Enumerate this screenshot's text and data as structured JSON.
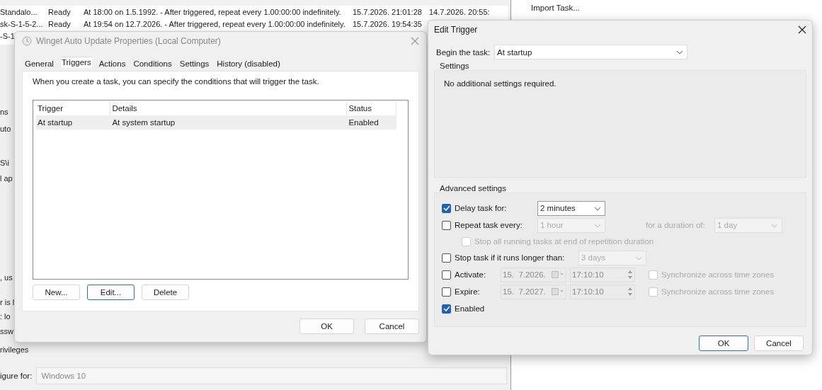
{
  "background": {
    "task_rows": [
      {
        "name": "Standalo...",
        "status": "Ready",
        "triggers": "At 18:00 on 1.5.1992. - After triggered, repeat every 1.00:00:00 indefinitely.",
        "next_run": "15.7.2026. 21:01:28",
        "last_run": "14.7.2026. 20:55:"
      },
      {
        "name": "sk-S-1-5-2...",
        "status": "Ready",
        "triggers": "At 19:54 on 12.7.2026. - After triggered, repeat every 1.00:00:00 indefinitely.",
        "next_run": "15.7.2026. 19:54:35"
      },
      {
        "name": "-S-1"
      }
    ],
    "actions": [
      "Import Task..."
    ],
    "fragments": [
      "ns",
      "uto",
      "S\\i",
      "l ap",
      ", us",
      "r is l",
      ": lo",
      "ssw",
      "rivileges"
    ],
    "configure": {
      "label": "igure for:",
      "value": "Windows 10"
    }
  },
  "properties": {
    "title": "Winget Auto Update Properties (Local Computer)",
    "tabs": [
      {
        "label": "General",
        "selected": false
      },
      {
        "label": "Triggers",
        "selected": true
      },
      {
        "label": "Actions",
        "selected": false
      },
      {
        "label": "Conditions",
        "selected": false
      },
      {
        "label": "Settings",
        "selected": false
      },
      {
        "label": "History (disabled)",
        "selected": false
      }
    ],
    "description": "When you create a task, you can specify the conditions that will trigger the task.",
    "table": {
      "columns": [
        "Trigger",
        "Details",
        "Status"
      ],
      "rows": [
        {
          "cells": [
            "At startup",
            "At system startup",
            "Enabled"
          ],
          "selected": true
        }
      ]
    },
    "buttons": [
      {
        "label": "New...",
        "focused": false
      },
      {
        "label": "Edit...",
        "focused": true
      },
      {
        "label": "Delete",
        "focused": false
      }
    ],
    "footer_buttons": [
      {
        "label": "OK",
        "focused": false
      },
      {
        "label": "Cancel",
        "focused": false
      }
    ]
  },
  "edit_trigger": {
    "title": "Edit Trigger",
    "begin_label": "Begin the task:",
    "begin_value": "At startup",
    "settings_title": "Settings",
    "settings_text": "No additional settings required.",
    "advanced_title": "Advanced settings",
    "advanced": [
      {
        "kind": "dropdown",
        "label": "Delay task for:",
        "checked": true,
        "value": "2 minutes"
      },
      {
        "kind": "repeat",
        "label": "Repeat task every:",
        "checked": false,
        "value": "1 hour",
        "duration_label": "for a duration of:",
        "duration": "1 day"
      },
      {
        "kind": "sub",
        "label": "Stop all running tasks at end of repetition duration",
        "checked": false
      },
      {
        "kind": "dropdown",
        "label": "Stop task if it runs longer than:",
        "checked": false,
        "value": "3 days"
      },
      {
        "kind": "date",
        "label": "Activate:",
        "checked": false,
        "date": "15.  7.2026.",
        "time": "17:10:10",
        "sync_label": "Synchronize across time zones",
        "sync_checked": false
      },
      {
        "kind": "date",
        "label": "Expire:",
        "checked": false,
        "date": "15.  7.2027.",
        "time": "17:10:10",
        "sync_label": "Synchronize across time zones",
        "sync_checked": false
      },
      {
        "kind": "check",
        "label": "Enabled",
        "checked": true
      }
    ],
    "buttons": [
      {
        "label": "OK",
        "focused": true
      },
      {
        "label": "Cancel",
        "focused": false
      }
    ]
  }
}
